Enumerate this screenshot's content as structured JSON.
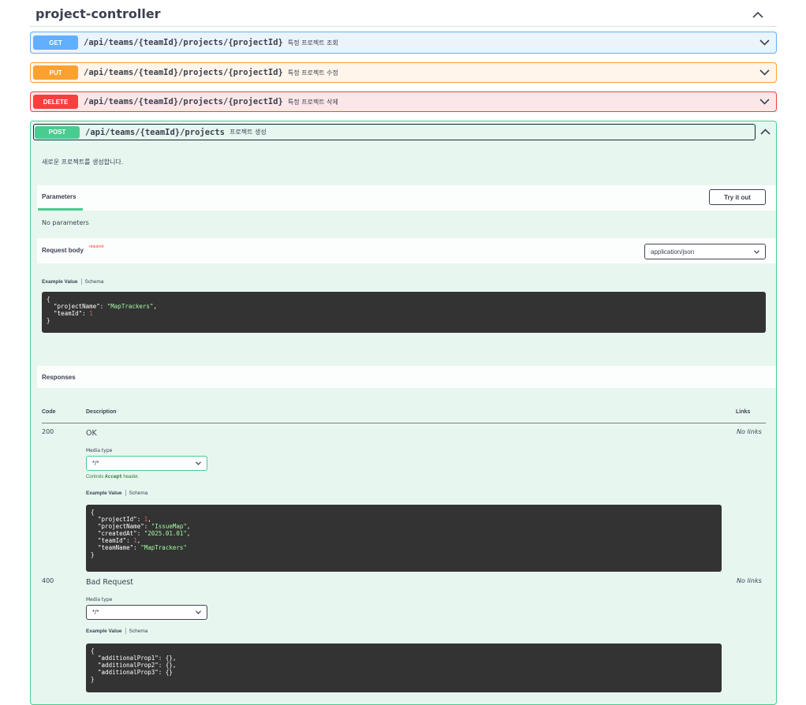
{
  "section": {
    "title": "project-controller"
  },
  "operations": [
    {
      "method": "GET",
      "path": "/api/teams/{teamId}/projects/{projectId}",
      "summary": "특정 프로젝트 조회"
    },
    {
      "method": "PUT",
      "path": "/api/teams/{teamId}/projects/{projectId}",
      "summary": "특정 프로젝트 수정"
    },
    {
      "method": "DELETE",
      "path": "/api/teams/{teamId}/projects/{projectId}",
      "summary": "특정 프로젝트 삭제"
    },
    {
      "method": "POST",
      "path": "/api/teams/{teamId}/projects",
      "summary": "프로젝트 생성"
    }
  ],
  "post": {
    "description": "새로운 프로젝트를 생성합니다.",
    "parameters_tab": "Parameters",
    "try_it_out": "Try it out",
    "no_parameters": "No parameters",
    "request_body_label": "Request body",
    "required_label": "required",
    "content_type": "application/json",
    "example_value_tab": "Example Value",
    "schema_tab": "Schema",
    "request_example": {
      "projectName": "MapTrackers",
      "teamId": "1"
    },
    "responses_label": "Responses",
    "columns": {
      "code": "Code",
      "description": "Description",
      "links": "Links"
    },
    "responses": [
      {
        "code": "200",
        "description": "OK",
        "media_type_label": "Media type",
        "media_type": "*/*",
        "controls_prefix": "Controls",
        "controls_code": "Accept",
        "controls_suffix": "header.",
        "links": "No links",
        "example": {
          "projectId": "1",
          "projectName": "IssueMap",
          "createdAt": "2025.01.01",
          "teamId": "1",
          "teamName": "MapTrackers"
        }
      },
      {
        "code": "400",
        "description": "Bad Request",
        "media_type_label": "Media type",
        "media_type": "*/*",
        "links": "No links",
        "example": {
          "additionalProp1": "{}",
          "additionalProp2": "{}",
          "additionalProp3": "{}"
        }
      }
    ]
  },
  "colors": {
    "get": "#61affe",
    "put": "#fca130",
    "delete": "#f93e3e",
    "post": "#49cc90"
  }
}
